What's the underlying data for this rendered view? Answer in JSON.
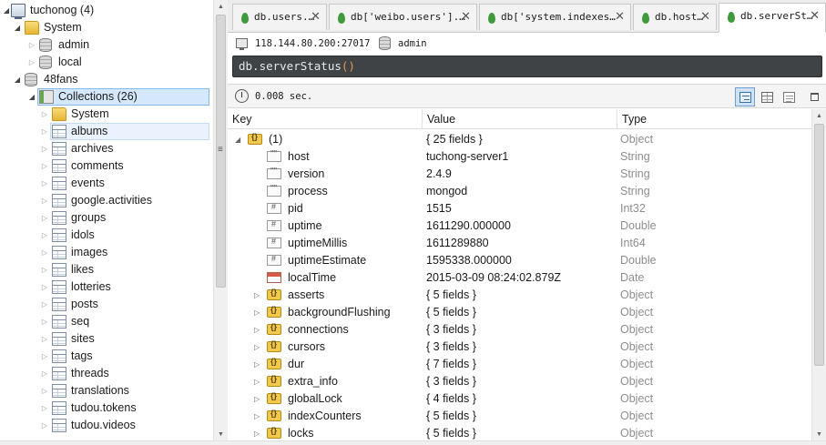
{
  "tree": {
    "nodes": [
      {
        "label": "tuchonog (4)",
        "icon": "server-icon",
        "level": 0,
        "expander": "expanded"
      },
      {
        "label": "System",
        "icon": "folder-icon",
        "level": 1,
        "expander": "expanded"
      },
      {
        "label": "admin",
        "icon": "database-icon",
        "level": 2,
        "expander": "collapsed"
      },
      {
        "label": "local",
        "icon": "database-icon",
        "level": 2,
        "expander": "collapsed"
      },
      {
        "label": "48fans",
        "icon": "database-icon",
        "level": 1,
        "expander": "expanded"
      },
      {
        "label": "Collections (26)",
        "icon": "collections-icon",
        "level": 2,
        "expander": "expanded",
        "state": "selected"
      },
      {
        "label": "System",
        "icon": "folder-icon",
        "level": 3,
        "expander": "collapsed"
      },
      {
        "label": "albums",
        "icon": "table-icon",
        "level": 3,
        "expander": "collapsed",
        "state": "hover"
      },
      {
        "label": "archives",
        "icon": "table-icon",
        "level": 3,
        "expander": "collapsed"
      },
      {
        "label": "comments",
        "icon": "table-icon",
        "level": 3,
        "expander": "collapsed"
      },
      {
        "label": "events",
        "icon": "table-icon",
        "level": 3,
        "expander": "collapsed"
      },
      {
        "label": "google.activities",
        "icon": "table-icon",
        "level": 3,
        "expander": "collapsed"
      },
      {
        "label": "groups",
        "icon": "table-icon",
        "level": 3,
        "expander": "collapsed"
      },
      {
        "label": "idols",
        "icon": "table-icon",
        "level": 3,
        "expander": "collapsed"
      },
      {
        "label": "images",
        "icon": "table-icon",
        "level": 3,
        "expander": "collapsed"
      },
      {
        "label": "likes",
        "icon": "table-icon",
        "level": 3,
        "expander": "collapsed"
      },
      {
        "label": "lotteries",
        "icon": "table-icon",
        "level": 3,
        "expander": "collapsed"
      },
      {
        "label": "posts",
        "icon": "table-icon",
        "level": 3,
        "expander": "collapsed"
      },
      {
        "label": "seq",
        "icon": "table-icon",
        "level": 3,
        "expander": "collapsed"
      },
      {
        "label": "sites",
        "icon": "table-icon",
        "level": 3,
        "expander": "collapsed"
      },
      {
        "label": "tags",
        "icon": "table-icon",
        "level": 3,
        "expander": "collapsed"
      },
      {
        "label": "threads",
        "icon": "table-icon",
        "level": 3,
        "expander": "collapsed"
      },
      {
        "label": "translations",
        "icon": "table-icon",
        "level": 3,
        "expander": "collapsed"
      },
      {
        "label": "tudou.tokens",
        "icon": "table-icon",
        "level": 3,
        "expander": "collapsed"
      },
      {
        "label": "tudou.videos",
        "icon": "table-icon",
        "level": 3,
        "expander": "collapsed"
      }
    ]
  },
  "tabs": [
    {
      "label": "db.users.…",
      "close": "✕"
    },
    {
      "label": "db['weibo.users'].…",
      "close": "✕"
    },
    {
      "label": "db['system.indexes…",
      "close": "✕"
    },
    {
      "label": "db.host…",
      "close": "✕"
    },
    {
      "label": "db.serverSt…",
      "close": "✕",
      "active": true
    }
  ],
  "connection": {
    "address": "118.144.80.200:27017",
    "database": "admin"
  },
  "query": {
    "text": "db.serverStatus",
    "parens": "()"
  },
  "result": {
    "time": "0.008 sec."
  },
  "grid": {
    "columns": [
      "Key",
      "Value",
      "Type"
    ],
    "rows": [
      {
        "key": "(1)",
        "value": "{ 25 fields }",
        "type": "Object",
        "icon": "object-icon",
        "depth": 0,
        "expander": "expanded"
      },
      {
        "key": "host",
        "value": "tuchong-server1",
        "type": "String",
        "icon": "string-icon",
        "depth": 1,
        "expander": "none"
      },
      {
        "key": "version",
        "value": "2.4.9",
        "type": "String",
        "icon": "string-icon",
        "depth": 1,
        "expander": "none"
      },
      {
        "key": "process",
        "value": "mongod",
        "type": "String",
        "icon": "string-icon",
        "depth": 1,
        "expander": "none"
      },
      {
        "key": "pid",
        "value": "1515",
        "type": "Int32",
        "icon": "number-icon",
        "depth": 1,
        "expander": "none"
      },
      {
        "key": "uptime",
        "value": "1611290.000000",
        "type": "Double",
        "icon": "number-icon",
        "depth": 1,
        "expander": "none"
      },
      {
        "key": "uptimeMillis",
        "value": "1611289880",
        "type": "Int64",
        "icon": "number-icon",
        "depth": 1,
        "expander": "none"
      },
      {
        "key": "uptimeEstimate",
        "value": "1595338.000000",
        "type": "Double",
        "icon": "number-icon",
        "depth": 1,
        "expander": "none"
      },
      {
        "key": "localTime",
        "value": "2015-03-09 08:24:02.879Z",
        "type": "Date",
        "icon": "date-icon",
        "depth": 1,
        "expander": "none"
      },
      {
        "key": "asserts",
        "value": "{ 5 fields }",
        "type": "Object",
        "icon": "object-icon",
        "depth": 1,
        "expander": "collapsed"
      },
      {
        "key": "backgroundFlushing",
        "value": "{ 5 fields }",
        "type": "Object",
        "icon": "object-icon",
        "depth": 1,
        "expander": "collapsed"
      },
      {
        "key": "connections",
        "value": "{ 3 fields }",
        "type": "Object",
        "icon": "object-icon",
        "depth": 1,
        "expander": "collapsed"
      },
      {
        "key": "cursors",
        "value": "{ 3 fields }",
        "type": "Object",
        "icon": "object-icon",
        "depth": 1,
        "expander": "collapsed"
      },
      {
        "key": "dur",
        "value": "{ 7 fields }",
        "type": "Object",
        "icon": "object-icon",
        "depth": 1,
        "expander": "collapsed"
      },
      {
        "key": "extra_info",
        "value": "{ 3 fields }",
        "type": "Object",
        "icon": "object-icon",
        "depth": 1,
        "expander": "collapsed"
      },
      {
        "key": "globalLock",
        "value": "{ 4 fields }",
        "type": "Object",
        "icon": "object-icon",
        "depth": 1,
        "expander": "collapsed"
      },
      {
        "key": "indexCounters",
        "value": "{ 5 fields }",
        "type": "Object",
        "icon": "object-icon",
        "depth": 1,
        "expander": "collapsed"
      },
      {
        "key": "locks",
        "value": "{ 5 fields }",
        "type": "Object",
        "icon": "object-icon",
        "depth": 1,
        "expander": "collapsed"
      }
    ]
  },
  "colors": {
    "query_bg": "#3f4345",
    "selection": "#d5e8fb",
    "type_text": "#8e8e8e"
  }
}
